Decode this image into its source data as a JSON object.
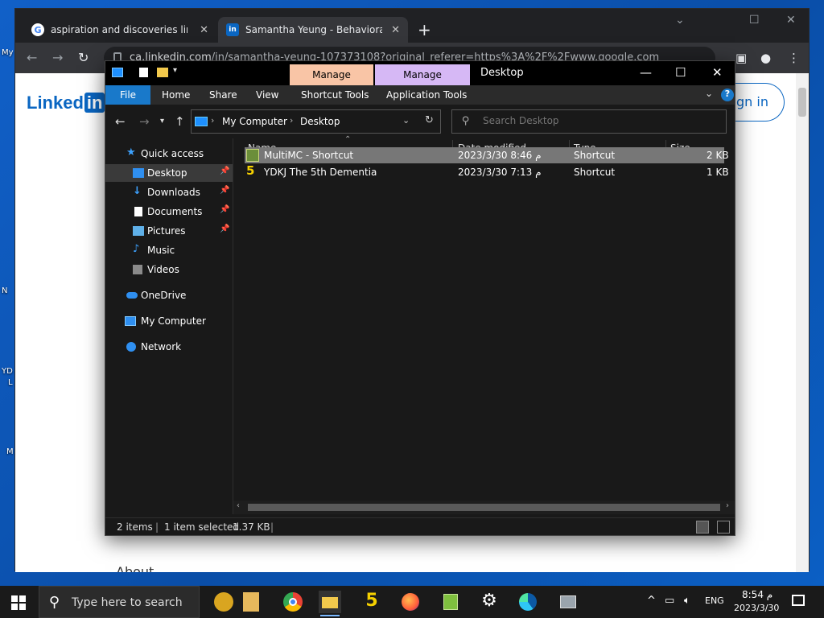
{
  "desktop": {
    "fragments": [
      "My",
      "N",
      "YD",
      "L",
      "M"
    ]
  },
  "browser": {
    "tabs": [
      {
        "title": "aspiration and discoveries linked",
        "close": "✕"
      },
      {
        "title": "Samantha Yeung - Behavioral Th",
        "close": "✕"
      }
    ],
    "new_tab": "+",
    "url_host": "ca.linkedin.com",
    "url_path": "/in/samantha-yeung-107373108?original_referer=https%3A%2F%2Fwww.google.com",
    "page": {
      "logo_text": "Linked",
      "logo_in": "in",
      "signin": "gn in",
      "about_fragment": "About"
    }
  },
  "explorer": {
    "window_title": "Desktop",
    "context_tabs": [
      {
        "label": "Manage",
        "color": "#f9c5a6"
      },
      {
        "label": "Manage",
        "color": "#d6b8f5"
      }
    ],
    "ribbon": {
      "file": "File",
      "tabs": [
        "Home",
        "Share",
        "View",
        "Shortcut Tools",
        "Application Tools"
      ],
      "help": "?"
    },
    "breadcrumb": [
      "My Computer",
      "Desktop"
    ],
    "search_placeholder": "Search Desktop",
    "nav": {
      "quick_access": "Quick access",
      "items": [
        {
          "label": "Desktop",
          "icon": "desktop-icon",
          "pinned": true
        },
        {
          "label": "Downloads",
          "icon": "downloads-icon",
          "pinned": true
        },
        {
          "label": "Documents",
          "icon": "documents-icon",
          "pinned": true
        },
        {
          "label": "Pictures",
          "icon": "pictures-icon",
          "pinned": true
        },
        {
          "label": "Music",
          "icon": "music-icon",
          "pinned": false
        },
        {
          "label": "Videos",
          "icon": "videos-icon",
          "pinned": false
        }
      ],
      "onedrive": "OneDrive",
      "my_computer": "My Computer",
      "network": "Network"
    },
    "columns": [
      "Name",
      "Date modified",
      "Type",
      "Size"
    ],
    "files": [
      {
        "name": "MultiMC - Shortcut",
        "date": "2023/3/30 م 8:46",
        "type": "Shortcut",
        "size": "2 KB",
        "selected": true
      },
      {
        "name": "YDKJ The 5th Dementia",
        "date": "2023/3/30 م 7:13",
        "type": "Shortcut",
        "size": "1 KB",
        "selected": false
      }
    ],
    "status": {
      "items": "2 items",
      "selected": "1 item selected",
      "size": "1.37 KB"
    },
    "accent": "#1979ca"
  },
  "taskbar": {
    "search_placeholder": "Type here to search",
    "language": "ENG",
    "time": "8:54 م",
    "date": "2023/3/30"
  }
}
